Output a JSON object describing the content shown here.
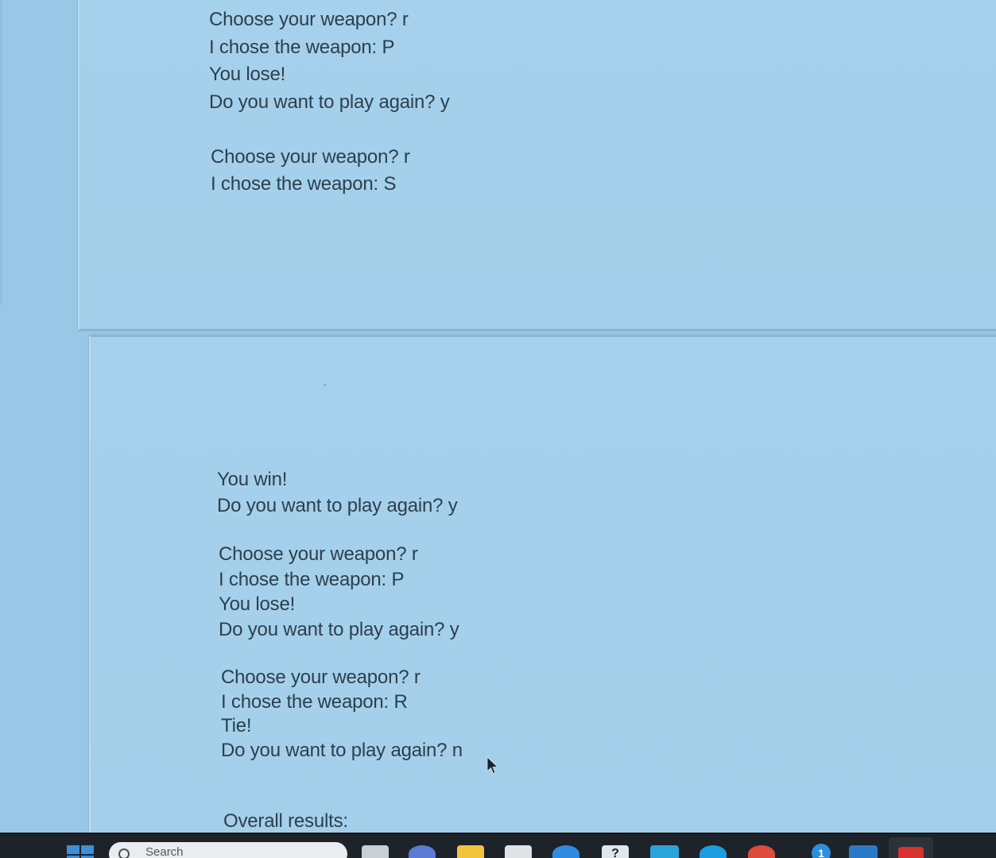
{
  "document": {
    "page1": {
      "block1": [
        "Choose your weapon? r",
        "I chose the weapon: P",
        "You lose!",
        "Do you want to play again? y"
      ],
      "block2": [
        "Choose your weapon? r",
        "I chose the weapon: S"
      ]
    },
    "page2": {
      "block3": [
        "You win!",
        "Do you want to play again? y"
      ],
      "block4": [
        "Choose your weapon? r",
        "I chose the weapon: P",
        "You lose!",
        "Do you want to play again? y"
      ],
      "block5": [
        "Choose your weapon? r",
        "I chose the weapon: R",
        "Tie!",
        "Do you want to play again? n"
      ],
      "block6": [
        "Overall results:"
      ]
    }
  },
  "taskbar": {
    "search_placeholder": "Search",
    "help_glyph": "?",
    "notification_count": "1",
    "icons": [
      "start-icon",
      "search-icon",
      "task-view-icon",
      "chat-icon",
      "file-explorer-icon",
      "store-icon",
      "mail-icon",
      "help-icon",
      "app-icon",
      "edge-icon",
      "chrome-icon",
      "notification-badge-icon",
      "app-icon",
      "pdf-app-icon"
    ]
  },
  "colors": {
    "page_background": "#a5d1ec",
    "text": "#2c3f4c",
    "taskbar": "#1d2328",
    "accent": "#3d8fd9"
  }
}
